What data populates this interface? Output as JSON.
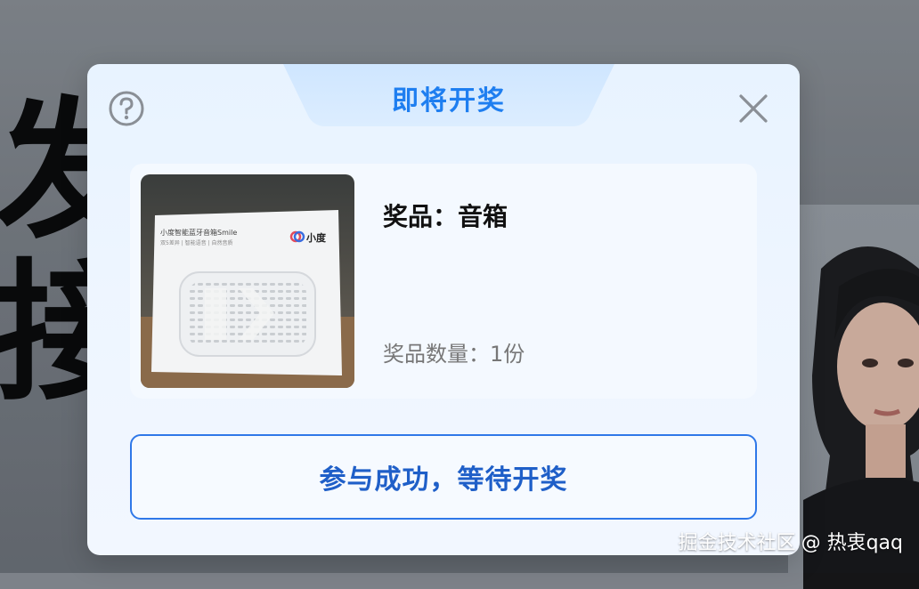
{
  "background": {
    "char_1": "发",
    "char_2": "接"
  },
  "modal": {
    "title": "即将开奖",
    "help_icon": "question-circle-icon",
    "close_icon": "close-icon",
    "prize": {
      "name_label": "奖品：",
      "name_value": "音箱",
      "quantity_label": "奖品数量：",
      "quantity_value": "1份",
      "image": {
        "box_title": "小度智能蓝牙音箱Smile",
        "box_subtitle": "双5差异 | 智能语音 | 自然音质",
        "brand": "小度"
      }
    },
    "status_button_label": "参与成功，等待开奖"
  },
  "watermark": {
    "site": "掘金技术社区",
    "author": "@ 热衷qaq"
  },
  "colors": {
    "accent": "#1e7ef0",
    "button_border": "#2f78e8",
    "button_text": "#1f5fc8"
  }
}
